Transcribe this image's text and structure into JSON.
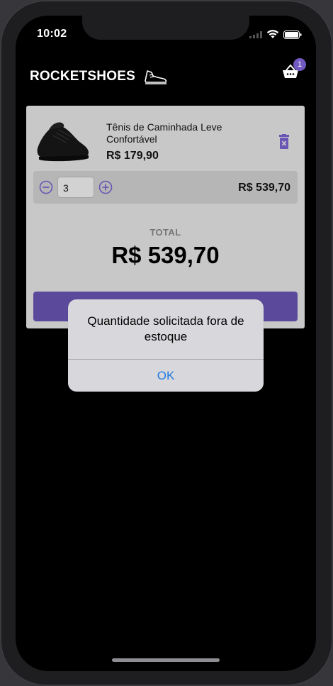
{
  "status_bar": {
    "time": "10:02"
  },
  "header": {
    "logo_text": "ROCKETSHOES",
    "logo_icon": "shoe-icon",
    "cart_icon": "basket-icon",
    "cart_count": "1"
  },
  "cart": {
    "item": {
      "title": "Tênis de Caminhada Leve Confortável",
      "price": "R$ 179,90",
      "quantity": "3",
      "subtotal": "R$ 539,70"
    },
    "total_label": "TOTAL",
    "total_value": "R$ 539,70",
    "colors": {
      "accent": "#7159c1",
      "button": "#5b4a9c"
    }
  },
  "alert": {
    "message": "Quantidade solicitada fora de estoque",
    "ok_label": "OK",
    "ok_color": "#1f7ae0"
  }
}
